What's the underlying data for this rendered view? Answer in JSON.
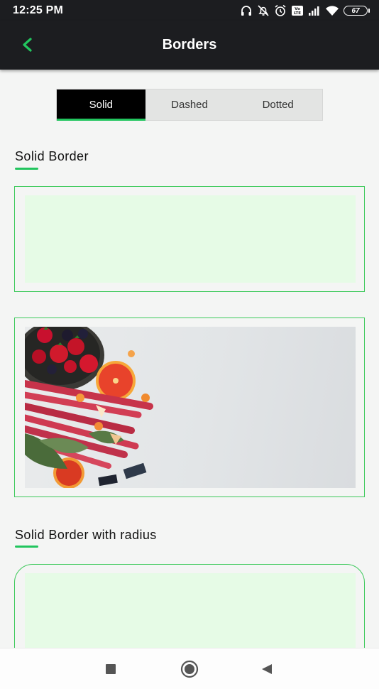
{
  "status_bar": {
    "time": "12:25 PM",
    "battery": "67",
    "icons": [
      "headphones-icon",
      "bell-off-icon",
      "alarm-icon",
      "volte-icon",
      "signal-icon",
      "wifi-icon",
      "battery-icon"
    ]
  },
  "app_bar": {
    "title": "Borders",
    "back_icon": "chevron-left-icon"
  },
  "tabs": [
    {
      "label": "Solid",
      "active": true
    },
    {
      "label": "Dashed",
      "active": false
    },
    {
      "label": "Dotted",
      "active": false
    }
  ],
  "sections": [
    {
      "title": "Solid Border"
    },
    {
      "title": "Solid Border with radius"
    }
  ],
  "colors": {
    "accent": "#22c55e",
    "border": "#3cc95a",
    "fill": "#e6fbe6",
    "bar_bg": "#1c1d20",
    "page_bg": "#f4f5f4"
  },
  "nav_bar": {
    "icons": [
      "recent-apps-icon",
      "home-icon",
      "back-triangle-icon"
    ]
  }
}
